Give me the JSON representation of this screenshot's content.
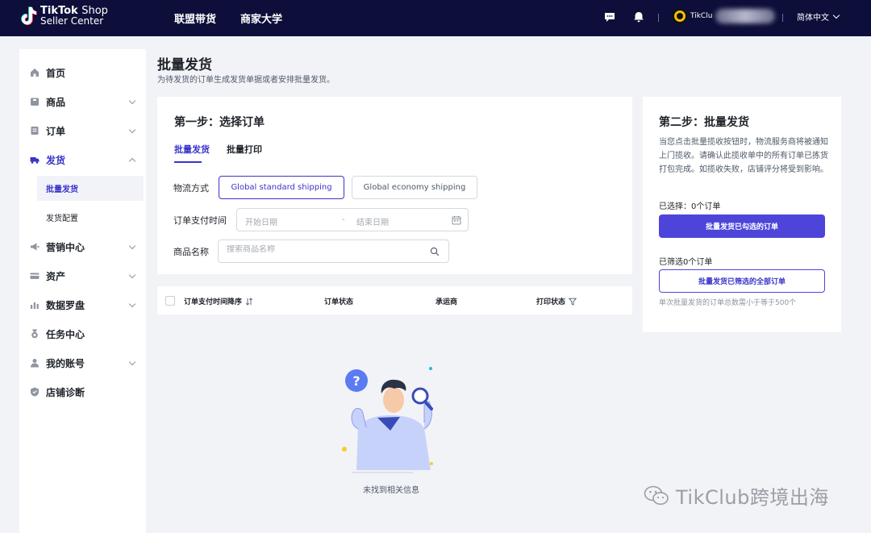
{
  "brand": {
    "line1_bold": "TikTok",
    "line1_thin": "Shop",
    "line2": "Seller Center"
  },
  "topnav": [
    "联盟带货",
    "商家大学"
  ],
  "user": {
    "name": "TikClu"
  },
  "language": "简体中文",
  "sidebar": {
    "items": [
      {
        "label": "首页",
        "icon": "home-icon"
      },
      {
        "label": "商品",
        "icon": "product-icon"
      },
      {
        "label": "订单",
        "icon": "order-icon"
      },
      {
        "label": "发货",
        "icon": "truck-icon"
      },
      {
        "label": "营销中心",
        "icon": "megaphone-icon"
      },
      {
        "label": "资产",
        "icon": "wallet-icon"
      },
      {
        "label": "数据罗盘",
        "icon": "chart-icon"
      },
      {
        "label": "任务中心",
        "icon": "medal-icon"
      },
      {
        "label": "我的账号",
        "icon": "user-icon"
      },
      {
        "label": "店铺诊断",
        "icon": "shield-icon"
      }
    ],
    "sub_items": [
      "批量发货",
      "发货配置"
    ]
  },
  "page": {
    "title": "批量发货",
    "description": "为待发货的订单生成发货单据或者安排批量发货。"
  },
  "step1": {
    "title": "第一步：选择订单",
    "tabs": [
      "批量发货",
      "批量打印"
    ],
    "shipping_label": "物流方式",
    "shipping_options": [
      "Global standard shipping",
      "Global economy shipping"
    ],
    "payment_time_label": "订单支付时间",
    "start_date_placeholder": "开始日期",
    "date_separator": "-",
    "end_date_placeholder": "结束日期",
    "product_name_label": "商品名称",
    "search_placeholder": "搜索商品名称"
  },
  "table": {
    "columns": [
      "订单支付时间降序",
      "订单状态",
      "承运商",
      "打印状态"
    ]
  },
  "empty": {
    "text": "未找到相关信息"
  },
  "step2": {
    "title": "第二步：批量发货",
    "description": "当您点击批量揽收按钮时，物流服务商将被通知上门揽收。请确认此揽收单中的所有订单已拣货打包完成。如揽收失败，店铺评分将受到影响。",
    "selected_text": "已选择：0个订单",
    "ship_selected_button": "批量发货已勾选的订单",
    "filtered_text": "已筛选0个订单",
    "ship_filtered_button": "批量发货已筛选的全部订单",
    "hint": "单次批量发货的订单总数需小于等于500个"
  },
  "watermark": "TikClub跨境出海",
  "colors": {
    "topbar": "#0d0f3a",
    "accent": "#3a34c9",
    "primary_button": "#4d45d9"
  }
}
